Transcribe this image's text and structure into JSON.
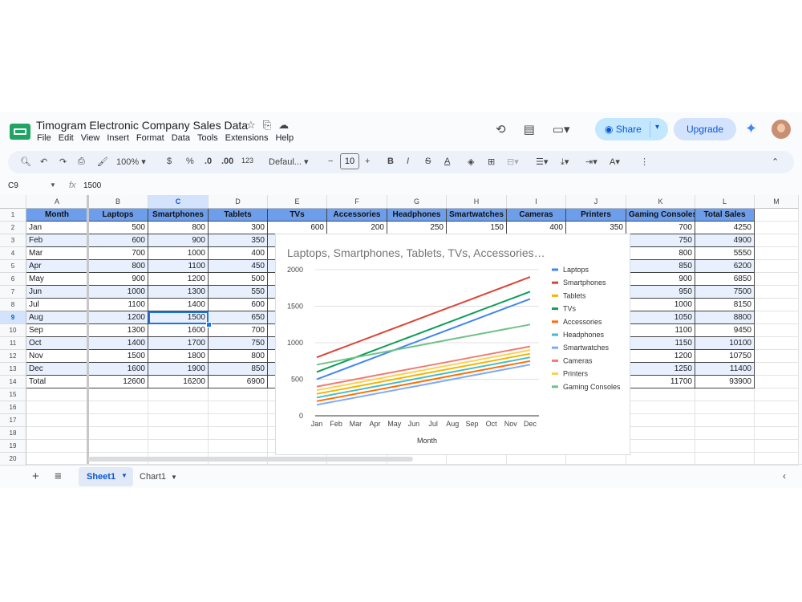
{
  "app": {
    "title": "Timogram Electronic Company Sales Data",
    "menu": [
      "File",
      "Edit",
      "View",
      "Insert",
      "Format",
      "Data",
      "Tools",
      "Extensions",
      "Help"
    ],
    "share_label": "Share",
    "upgrade_label": "Upgrade"
  },
  "toolbar": {
    "zoom": "100%",
    "currency": "$",
    "percent": "%",
    "dec_decrease": ".0",
    "dec_increase": ".00",
    "number_format": "123",
    "font": "Defaul...",
    "font_size": "10"
  },
  "formula_bar": {
    "cell_ref": "C9",
    "fx": "fx",
    "value": "1500"
  },
  "sheet": {
    "col_letters": [
      "A",
      "B",
      "C",
      "D",
      "E",
      "F",
      "G",
      "H",
      "I",
      "J",
      "K",
      "L",
      "M"
    ],
    "row_numbers": [
      "1",
      "2",
      "3",
      "4",
      "5",
      "6",
      "7",
      "8",
      "9",
      "10",
      "11",
      "12",
      "13",
      "14",
      "15",
      "16",
      "17",
      "18",
      "19",
      "20"
    ],
    "headers": [
      "Month",
      "Laptops",
      "Smartphones",
      "Tablets",
      "TVs",
      "Accessories",
      "Headphones",
      "Smartwatches",
      "Cameras",
      "Printers",
      "Gaming Consoles",
      "Total Sales"
    ],
    "rows": [
      [
        "Jan",
        "500",
        "800",
        "300",
        "600",
        "200",
        "250",
        "150",
        "400",
        "350",
        "700",
        "4250"
      ],
      [
        "Feb",
        "600",
        "900",
        "350",
        "",
        "",
        "",
        "",
        "",
        "",
        "750",
        "4900"
      ],
      [
        "Mar",
        "700",
        "1000",
        "400",
        "",
        "",
        "",
        "",
        "",
        "",
        "800",
        "5550"
      ],
      [
        "Apr",
        "800",
        "1100",
        "450",
        "",
        "",
        "",
        "",
        "",
        "",
        "850",
        "6200"
      ],
      [
        "May",
        "900",
        "1200",
        "500",
        "",
        "",
        "",
        "",
        "",
        "",
        "900",
        "6850"
      ],
      [
        "Jun",
        "1000",
        "1300",
        "550",
        "",
        "",
        "",
        "",
        "",
        "",
        "950",
        "7500"
      ],
      [
        "Jul",
        "1100",
        "1400",
        "600",
        "",
        "",
        "",
        "",
        "",
        "",
        "1000",
        "8150"
      ],
      [
        "Aug",
        "1200",
        "1500",
        "650",
        "",
        "",
        "",
        "",
        "",
        "",
        "1050",
        "8800"
      ],
      [
        "Sep",
        "1300",
        "1600",
        "700",
        "",
        "",
        "",
        "",
        "",
        "",
        "1100",
        "9450"
      ],
      [
        "Oct",
        "1400",
        "1700",
        "750",
        "",
        "",
        "",
        "",
        "",
        "",
        "1150",
        "10100"
      ],
      [
        "Nov",
        "1500",
        "1800",
        "800",
        "",
        "",
        "",
        "",
        "",
        "",
        "1200",
        "10750"
      ],
      [
        "Dec",
        "1600",
        "1900",
        "850",
        "",
        "",
        "",
        "",
        "",
        "",
        "1250",
        "11400"
      ],
      [
        "Total",
        "12600",
        "16200",
        "6900",
        "",
        "",
        "",
        "",
        "",
        "",
        "11700",
        "93900"
      ]
    ]
  },
  "tabs": {
    "sheet1": "Sheet1",
    "chart1": "Chart1"
  },
  "chart_data": {
    "type": "line",
    "title": "Laptops, Smartphones, Tablets, TVs, Accessories…",
    "xlabel": "Month",
    "ylabel": "",
    "ylim": [
      0,
      2000
    ],
    "yticks": [
      "0",
      "500",
      "1000",
      "1500",
      "2000"
    ],
    "grid": true,
    "legend": "right",
    "categories": [
      "Jan",
      "Feb",
      "Mar",
      "Apr",
      "May",
      "Jun",
      "Jul",
      "Aug",
      "Sep",
      "Oct",
      "Nov",
      "Dec"
    ],
    "series": [
      {
        "name": "Laptops",
        "color": "#4285f4",
        "values": [
          500,
          600,
          700,
          800,
          900,
          1000,
          1100,
          1200,
          1300,
          1400,
          1500,
          1600
        ]
      },
      {
        "name": "Smartphones",
        "color": "#db4437",
        "values": [
          800,
          900,
          1000,
          1100,
          1200,
          1300,
          1400,
          1500,
          1600,
          1700,
          1800,
          1900
        ]
      },
      {
        "name": "Tablets",
        "color": "#f4b400",
        "values": [
          300,
          350,
          400,
          450,
          500,
          550,
          600,
          650,
          700,
          750,
          800,
          850
        ]
      },
      {
        "name": "TVs",
        "color": "#0f9d58",
        "values": [
          600,
          700,
          800,
          900,
          1000,
          1100,
          1200,
          1300,
          1400,
          1500,
          1600,
          1700
        ]
      },
      {
        "name": "Accessories",
        "color": "#ff6d01",
        "values": [
          200,
          250,
          300,
          350,
          400,
          450,
          500,
          550,
          600,
          650,
          700,
          750
        ]
      },
      {
        "name": "Headphones",
        "color": "#46bdc6",
        "values": [
          250,
          300,
          350,
          400,
          450,
          500,
          550,
          600,
          650,
          700,
          750,
          800
        ]
      },
      {
        "name": "Smartwatches",
        "color": "#7baaf7",
        "values": [
          150,
          200,
          250,
          300,
          350,
          400,
          450,
          500,
          550,
          600,
          650,
          700
        ]
      },
      {
        "name": "Cameras",
        "color": "#f07b72",
        "values": [
          400,
          450,
          500,
          550,
          600,
          650,
          700,
          750,
          800,
          850,
          900,
          950
        ]
      },
      {
        "name": "Printers",
        "color": "#fcd04f",
        "values": [
          350,
          400,
          450,
          500,
          550,
          600,
          650,
          700,
          750,
          800,
          850,
          900
        ]
      },
      {
        "name": "Gaming Consoles",
        "color": "#71c287",
        "values": [
          700,
          750,
          800,
          850,
          900,
          950,
          1000,
          1050,
          1100,
          1150,
          1200,
          1250
        ]
      }
    ]
  }
}
